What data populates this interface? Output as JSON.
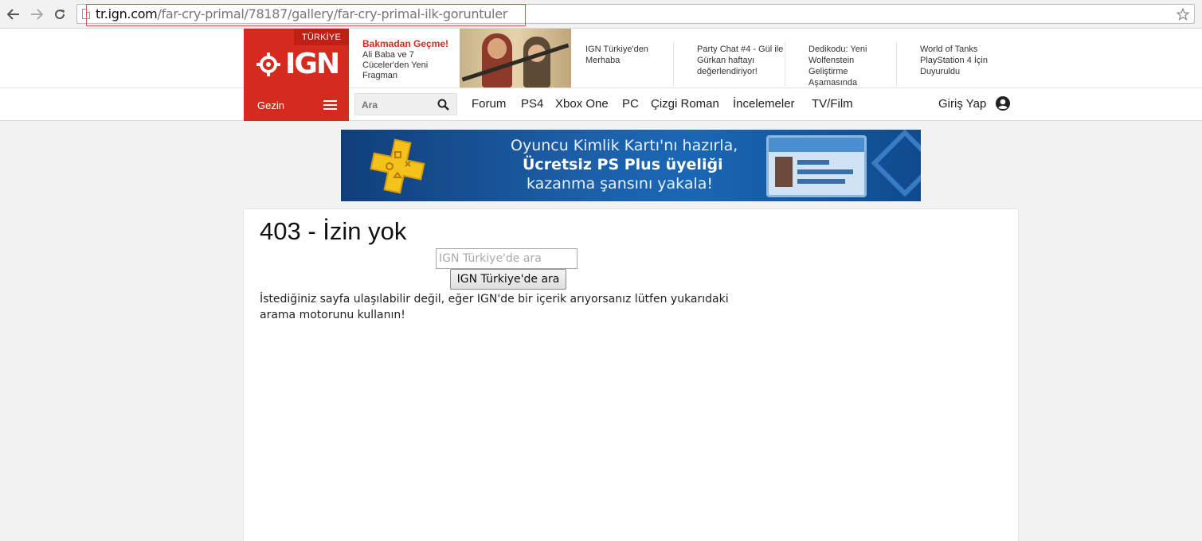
{
  "browser": {
    "url_host": "tr.ign.com",
    "url_path": "/far-cry-primal/78187/gallery/far-cry-primal-ilk-goruntuler"
  },
  "header": {
    "region_badge": "TÜRKİYE",
    "logo_text": "IGN",
    "promo": {
      "title": "Bakmadan Geçme!",
      "body": "Ali Baba ve 7 Cüceler'den Yeni Fragman"
    },
    "news": [
      "IGN Türkiye'den Merhaba",
      "Party Chat #4 - Gül ile Gürkan haftayı değerlendiriyor!",
      "Dedikodu: Yeni Wolfenstein Geliştirme Aşamasında",
      "World of Tanks PlayStation 4 İçin Duyuruldu"
    ],
    "browse_label": "Gezin",
    "search_placeholder": "Ara",
    "menu": [
      "Forum",
      "PS4",
      "Xbox One",
      "PC",
      "Çizgi Roman",
      "İncelemeler",
      "TV/Film"
    ],
    "login_label": "Giriş Yap"
  },
  "banner": {
    "line1": "Oyuncu Kimlik Kartı'nı hazırla,",
    "line2": "Ücretsiz PS Plus üyeliği",
    "line3": "kazanma şansını yakala!"
  },
  "content": {
    "title": "403 - İzin yok",
    "search_placeholder": "IGN Türkiye'de ara",
    "search_button": "IGN Türkiye'de ara",
    "message": "İstediğiniz sayfa ulaşılabilir değil, eğer IGN'de bir içerik arıyorsanız lütfen yukarıdaki arama motorunu kullanın!"
  },
  "colors": {
    "brand_red": "#d52b1e",
    "highlight_box": "#d9534f"
  }
}
